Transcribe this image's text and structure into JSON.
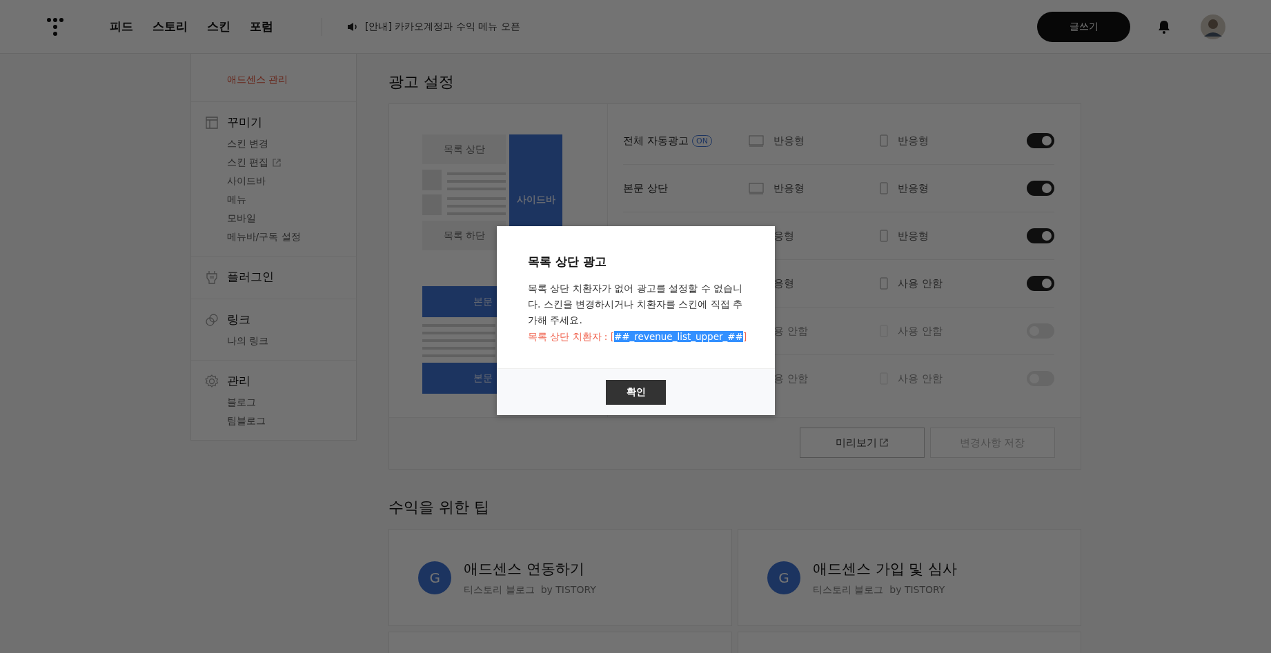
{
  "header": {
    "nav": [
      {
        "label": "피드"
      },
      {
        "label": "스토리"
      },
      {
        "label": "스킨"
      },
      {
        "label": "포럼"
      }
    ],
    "notice": {
      "tag": "[안내]",
      "text": "카카오계정과 수익 메뉴 오픈"
    },
    "write_button": "글쓰기"
  },
  "sidebar": {
    "sections": [
      {
        "items": [
          {
            "label": "애드센스 관리",
            "selected": true,
            "external": false
          }
        ]
      },
      {
        "title": "꾸미기",
        "items": [
          {
            "label": "스킨 변경",
            "selected": false,
            "external": false
          },
          {
            "label": "스킨 편집",
            "selected": false,
            "external": true
          },
          {
            "label": "사이드바",
            "selected": false,
            "external": false
          },
          {
            "label": "메뉴",
            "selected": false,
            "external": false
          },
          {
            "label": "모바일",
            "selected": false,
            "external": false
          },
          {
            "label": "메뉴바/구독 설정",
            "selected": false,
            "external": false
          }
        ]
      },
      {
        "title": "플러그인"
      },
      {
        "title": "링크",
        "items": [
          {
            "label": "나의 링크",
            "selected": false,
            "external": false
          }
        ]
      },
      {
        "title": "관리",
        "items": [
          {
            "label": "블로그",
            "selected": false,
            "external": false
          },
          {
            "label": "팀블로그",
            "selected": false,
            "external": false
          }
        ]
      }
    ]
  },
  "ad_settings": {
    "title": "광고 설정",
    "preview": {
      "top": "목록 상단",
      "sidebar": "사이드바",
      "bottom": "목록 하단",
      "body_top": "본문",
      "body_bottom": "본문"
    },
    "rows": [
      {
        "name": "전체 자동광고",
        "badge": "ON",
        "pc_icon": true,
        "pc": "반응형",
        "mobile": "반응형",
        "on": true,
        "disabled": false
      },
      {
        "name": "본문 상단",
        "pc_icon": true,
        "pc": "반응형",
        "mobile": "반응형",
        "on": true,
        "disabled": false
      },
      {
        "pc_icon": false,
        "pc": "응형",
        "mobile": "반응형",
        "on": true,
        "disabled": false
      },
      {
        "pc_icon": false,
        "pc": "응형",
        "mobile": "사용 안함",
        "on": true,
        "disabled": false
      },
      {
        "pc_icon": false,
        "pc": "용 안함",
        "mobile": "사용 안함",
        "on": false,
        "disabled": true
      },
      {
        "pc_icon": false,
        "pc": "용 안함",
        "mobile": "사용 안함",
        "on": false,
        "disabled": true
      }
    ],
    "preview_button": "미리보기",
    "save_button": {
      "label": "변경사항 저장",
      "disabled": true
    }
  },
  "tips": {
    "title": "수익을 위한 팁",
    "cards": [
      {
        "kind": "tip",
        "icon": "G",
        "title": "애드센스 연동하기",
        "source": "티스토리 블로그",
        "by": "by TISTORY"
      },
      {
        "kind": "tip",
        "icon": "G",
        "title": "애드센스 가입 및 심사",
        "source": "티스토리 블로그",
        "by": "by TISTORY"
      },
      {
        "kind": "blank"
      },
      {
        "kind": "blank"
      }
    ]
  },
  "modal": {
    "title": "목록 상단 광고",
    "message": "목록 상단 치환자가 없어 광고를 설정할 수 없습니다. 스킨을 변경하시거나 치환자를 스킨에 직접 추가해 주세요.",
    "placeholder_line": {
      "prefix": "목록 상단 치환자 : [",
      "code": "##_revenue_list_upper_##",
      "suffix": "]",
      "code_selected": true
    },
    "confirm": "확인"
  }
}
